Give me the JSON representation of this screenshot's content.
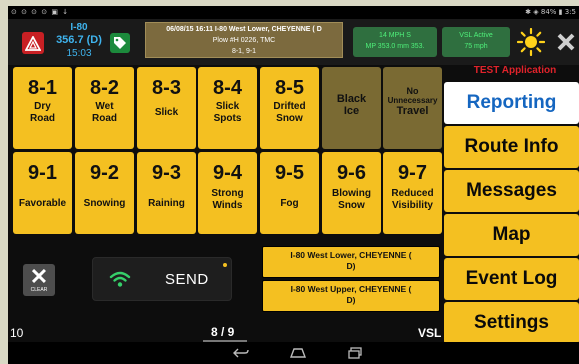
{
  "statusbar": {
    "left_icons": "⊙ ⊙ ⊙ ⊙ ▣ ↓",
    "right_text": "✱ ◈ 84% ▮ 3:5"
  },
  "header": {
    "road": "I-80",
    "milepost": "356.7 (D)",
    "time": "15:03",
    "event_line1": "06/08/15 16:11 I-80 West Lower, CHEYENNE ( D",
    "event_line2": "Plow #H 0226, TMC",
    "event_line3": "8-1, 9-1",
    "speed_line1": "14 MPH S",
    "speed_line2": "MP 353.0 mm 353.",
    "vsl_line1": "VSL Active",
    "vsl_line2": "75 mph",
    "test_banner": "TEST Application",
    "icons": [
      "hazard-triangle-icon",
      "tag-icon",
      "sun-icon",
      "close-icon"
    ]
  },
  "conditions": {
    "row1": [
      {
        "code": "8-1",
        "label": "Dry Road"
      },
      {
        "code": "8-2",
        "label": "Wet Road"
      },
      {
        "code": "8-3",
        "label": "Slick"
      },
      {
        "code": "8-4",
        "label": "Slick Spots"
      },
      {
        "code": "8-5",
        "label": "Drifted Snow"
      },
      {
        "code": "",
        "label": "Black Ice"
      },
      {
        "code": "",
        "label": "No Unnecessary Travel"
      }
    ],
    "row2": [
      {
        "code": "9-1",
        "label": "Favorable"
      },
      {
        "code": "9-2",
        "label": "Snowing"
      },
      {
        "code": "9-3",
        "label": "Raining"
      },
      {
        "code": "9-4",
        "label": "Strong Winds"
      },
      {
        "code": "9-5",
        "label": "Fog"
      },
      {
        "code": "9-6",
        "label": "Blowing Snow"
      },
      {
        "code": "9-7",
        "label": "Reduced Visibility"
      }
    ],
    "no_travel_top": "No",
    "no_travel_mid": "Unnecessary",
    "no_travel_bottom": "Travel"
  },
  "controls": {
    "clear_label": "CLEAR",
    "send_label": "SEND"
  },
  "routes": [
    {
      "line1": "I-80 West Lower, CHEYENNE (",
      "line2": "D)"
    },
    {
      "line1": "I-80 West Upper, CHEYENNE (",
      "line2": "D)"
    }
  ],
  "menu": {
    "items": [
      {
        "label": "Reporting",
        "active": true
      },
      {
        "label": "Route Info",
        "active": false
      },
      {
        "label": "Messages",
        "active": false
      },
      {
        "label": "Map",
        "active": false
      },
      {
        "label": "Event Log",
        "active": false
      },
      {
        "label": "Settings",
        "active": false
      }
    ]
  },
  "footer": {
    "left_num": "10",
    "page": "8 / 9",
    "right_label": "VSL"
  },
  "colors": {
    "tile_yellow": "#f4c021",
    "tile_dim": "#7a6a33",
    "hazard_red": "#c82024",
    "tag_green": "#1c8a3c",
    "speed_green": "#2f6f3f",
    "active_blue": "#1566c0",
    "test_red": "#e0232b"
  }
}
